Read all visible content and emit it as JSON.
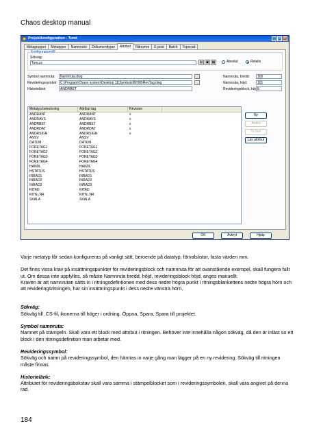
{
  "document": {
    "title": "Chaos desktop manual",
    "page_number": "184"
  },
  "dialog": {
    "title": "Projektkonfiguration - Tomt",
    "tabs": [
      "Metagrupper",
      "Metatyper",
      "Namnrutor",
      "Dokumenttyper",
      "Attribut",
      "Ritnumre",
      "E-post",
      "Batch",
      "Topocad"
    ],
    "active_tab": "Attribut",
    "group_label": "Konfigurationsfil",
    "sokvag_label": "Sökväg:",
    "sokvag_value": "Tom.cs",
    "absolut_label": "Absolut",
    "relativ_label": "Relativ",
    "symbol_namnruta_label": "Symbol namnruta:",
    "symbol_namnruta_value": "Namnruta.dwg",
    "revideringssymbol_label": "Revideringssymbol:",
    "revideringssymbol_value": "C:\\Program\\Chaos system\\Desktop 11\\Symbols\\BH90\\RevTag.dwg",
    "historielank_label": "Historielänk:",
    "historielank_value": "ANDRBET",
    "namnruta_bredd_label": "Namnruta, bredd:",
    "namnruta_bredd_value": "100",
    "namnruta_hojd_label": "Namnruta, höjd:",
    "namnruta_hojd_value": "101",
    "revblock_hojd_label": "Revideringsblock, höjd:",
    "revblock_hojd_value": "8",
    "columns": [
      "Metatyp beteckning",
      "Attribut tag",
      "Revision"
    ],
    "rows": [
      [
        "ANDRANT",
        "ANDRANT",
        "x"
      ],
      [
        "ANDRAVS",
        "ANDRAVS",
        "x"
      ],
      [
        "ANDRBET",
        "ANDRBET",
        "x"
      ],
      [
        "ANDRDAT",
        "ANDRDAT",
        "x"
      ],
      [
        "ANDRSIGN",
        "ANDRSIGN",
        "x"
      ],
      [
        "ANSV",
        "ANSV",
        ""
      ],
      [
        "DATUM",
        "DATUM",
        ""
      ],
      [
        "FORETAG1",
        "FORETAG1",
        ""
      ],
      [
        "FORETAG2",
        "FORETAG2",
        ""
      ],
      [
        "FORETAG3",
        "FORETAG3",
        ""
      ],
      [
        "FORETAG4",
        "FORETAG4",
        ""
      ],
      [
        "HANDL",
        "HANDL",
        ""
      ],
      [
        "HSTATUS",
        "HSTATUS",
        ""
      ],
      [
        "INRAD1",
        "INRAD1",
        ""
      ],
      [
        "INRAD2",
        "INRAD2",
        ""
      ],
      [
        "INRAD3",
        "INRAD3",
        ""
      ],
      [
        "RITAD",
        "RITAD",
        ""
      ],
      [
        "RITN_NR",
        "RITN_NR",
        ""
      ],
      [
        "SKALA",
        "SKALA",
        ""
      ]
    ],
    "side_buttons": {
      "ny": "Ny",
      "andra": "Ändra",
      "ta_bort": "Ta bort",
      "las_attribut": "Läs attribut"
    },
    "footer_buttons": {
      "ok": "OK",
      "avbryt": "Avbryt",
      "hjalp": "Hjälp"
    }
  },
  "body": {
    "p1": "Varje metatyp får sedan konfigureras på vanligt sätt, beroende på datatyp, förvalslistor, fasta värden mm.",
    "p2": "Det finns vissa krav på insättningspunkter för revideringsblock och namnruta för att ovanstående exempel, skall fungera fullt ut. Om dessa inte uppfylles, så måste Namnruta bredd, höjd, revideringsblock höjd, anges manuellt.",
    "p3": "Kraven är att namnrutan sätts in i ritningsdefintionen med dess nedre högra punkt i ritningsblankettens nedre högra hörn och att revideringsritningen, har sin insättningspunkt i dess nedre vänstra hörn.",
    "h1": "Sökväg:",
    "t1": "Sökväg till .CS-fil, ikonerna till höger i ordning. Öppna, Spara, Spara till projektet.",
    "h2": "Symbol namnruta:",
    "t2": "Namnet på stämpeln. Skall vara ett block med attribut i ritningen. Behöver inte innehålla någon sökväg, då den är inläst so ett block i den ritningsdefinition man arbetar med.",
    "h3": "Revideringssymbol:",
    "t3": "Sökväg och namn på revideringssymbol, den hämtas in varje gång man lägger på en ny revidering. Sökväg till ritningen måste finnas.",
    "h4": "Historielänk:",
    "t4": "Attributet för revideringsbokstav skall vara samma i stämpelblocket som i revideringssymbolen, skall vara angivet på denna rad."
  }
}
